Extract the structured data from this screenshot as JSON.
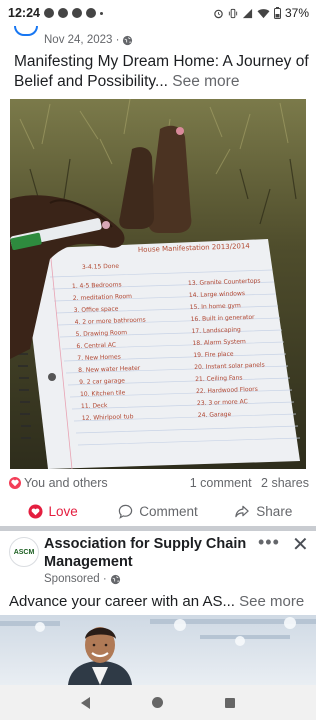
{
  "status_bar": {
    "time": "12:24",
    "battery": "37%",
    "icons": [
      "notification-icon",
      "notification-icon",
      "notification-icon",
      "settings-icon",
      "alarm-icon",
      "vibrate-icon",
      "signal-icon",
      "wifi-icon",
      "battery-icon"
    ]
  },
  "post": {
    "date": "Nov 24, 2023 ·",
    "audience_icon": "globe-icon",
    "text": "Manifesting My Dream Home: A Journey of Belief and Possibility...",
    "see_more": "See more",
    "photo": {
      "heading": "House Manifestation 2013/2014",
      "subheading": "3-4.15 Done",
      "list_left": [
        "1. 4-5 Bedrooms",
        "2. meditation Room",
        "3. Office space",
        "4. 2 or more bathrooms",
        "5. Drawing Room",
        "6. Central AC",
        "7. New Homes",
        "8. New water Heater",
        "9. 2 car garage",
        "10. Kitchen tile",
        "11. Deck",
        "12. Whirlpool tub"
      ],
      "list_right": [
        "13. Granite Countertops",
        "14. Large windows",
        "15. In home gym",
        "16. Built in generator",
        "17. Landscaping",
        "18. Alarm System",
        "19. Fire place",
        "20. Instant solar panels",
        "21. Ceiling Fans",
        "22. Hardwood Floors",
        "23. 3 or more AC",
        "24. Garage"
      ]
    },
    "reactions_text": "You and others",
    "comments": "1 comment",
    "shares": "2 shares",
    "actions": {
      "love": "Love",
      "comment": "Comment",
      "share": "Share"
    }
  },
  "ad": {
    "logo_text": "ASCM",
    "title": "Association for Supply Chain Management",
    "sponsored": "Sponsored ·",
    "text": "Advance your career with an AS...",
    "see_more": "See more"
  },
  "colors": {
    "love": "#e41e3f",
    "link_blue": "#1877f2",
    "secondary_text": "#65676b"
  }
}
